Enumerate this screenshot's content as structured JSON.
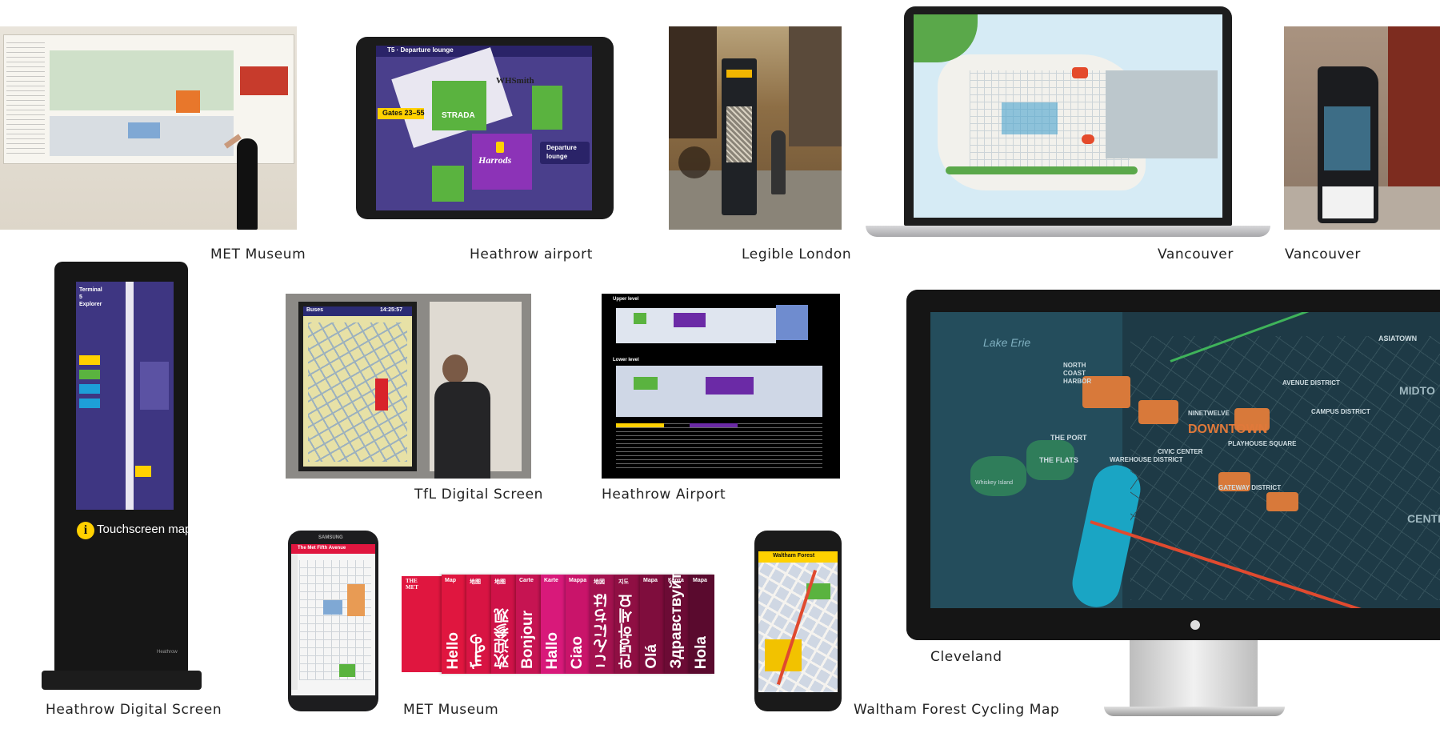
{
  "captions": {
    "met_museum_wall": "MET Museum",
    "heathrow_airport_tablet": "Heathrow airport",
    "legible_london": "Legible London",
    "vancouver_laptop": "Vancouver",
    "vancouver_totem": "Vancouver",
    "heathrow_digital_screen": "Heathrow Digital Screen",
    "tfl_digital_screen": "TfL Digital Screen",
    "heathrow_airport_plan": "Heathrow Airport",
    "cleveland": "Cleveland",
    "met_museum_brochures": "MET Museum",
    "waltham_forest": "Waltham Forest Cycling Map"
  },
  "tablet": {
    "top_bar": "T5 · Departure lounge",
    "gates": "Gates 23–55",
    "strada": "STRADA",
    "harrods": "Harrods",
    "whsmith": "WHSmith",
    "departure": "Departure lounge"
  },
  "kiosk": {
    "title": "Terminal 5 Explorer",
    "touchscreen": "Touchscreen map",
    "brand": "Heathrow"
  },
  "tfl": {
    "header": "Buses",
    "time": "14:25:57"
  },
  "heathrow_plan": {
    "upper": "Upper level",
    "lower": "Lower level"
  },
  "cleveland_map": {
    "lake": "Lake Erie",
    "downtown": "DOWNTOWN",
    "north_coast": "NORTH COAST HARBOR",
    "the_port": "THE PORT",
    "the_flats": "THE FLATS",
    "warehouse": "WAREHOUSE DISTRICT",
    "civic": "CIVIC CENTER",
    "gateway": "GATEWAY DISTRICT",
    "playhouse": "PLAYHOUSE SQUARE",
    "ninetwelve": "NINETWELVE",
    "campus": "CAMPUS DISTRICT",
    "asiatown": "ASIATOWN",
    "avenue": "AVENUE DISTRICT",
    "central": "CENTRA",
    "midtown": "MIDTO",
    "whiskey": "Whiskey Island"
  },
  "phone_met": {
    "brand": "SAMSUNG",
    "header": "The Met Fifth Avenue"
  },
  "brochures": [
    {
      "head": "Map",
      "word": "Hello",
      "color": "#e0163f"
    },
    {
      "head": "地图",
      "word": "ᠮᠡᠨᠳᠦ",
      "color": "#d81443"
    },
    {
      "head": "地图",
      "word": "欢迎参观",
      "color": "#cf1248"
    },
    {
      "head": "Carte",
      "word": "Bonjour",
      "color": "#c61452"
    },
    {
      "head": "Karte",
      "word": "Hallo",
      "color": "#d8197a"
    },
    {
      "head": "Mappa",
      "word": "Ciao",
      "color": "#c9146a"
    },
    {
      "head": "地図",
      "word": "こんにちは",
      "color": "#a3124f"
    },
    {
      "head": "지도",
      "word": "안녕하세요",
      "color": "#8f0f43"
    },
    {
      "head": "Mapa",
      "word": "Olá",
      "color": "#7f0d3d"
    },
    {
      "head": "Карта",
      "word": "Здравствуйте",
      "color": "#6c0b35"
    },
    {
      "head": "Mapa",
      "word": "Hola",
      "color": "#5a0a2e"
    }
  ],
  "brochure_logo": "THE MET",
  "phone_waltham": {
    "header": "Waltham Forest"
  }
}
